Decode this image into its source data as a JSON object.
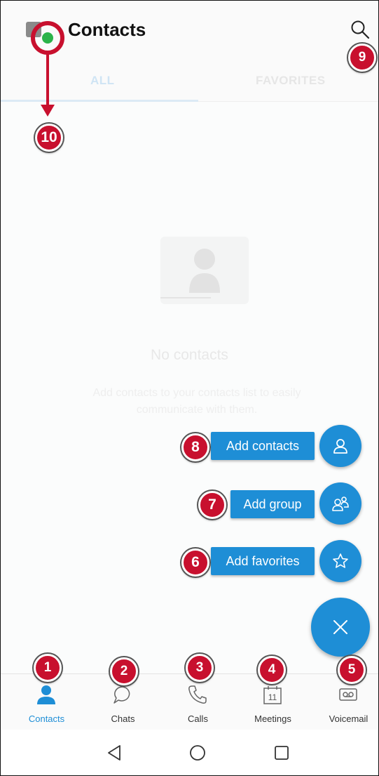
{
  "header": {
    "title": "Contacts"
  },
  "tabs": [
    {
      "label": "ALL"
    },
    {
      "label": "FAVORITES"
    }
  ],
  "empty_state": {
    "title": "No contacts",
    "description": "Add contacts to your contacts list to easily communicate with them."
  },
  "fab_actions": [
    {
      "label": "Add contacts",
      "icon": "person-icon",
      "callout": "8"
    },
    {
      "label": "Add group",
      "icon": "group-icon",
      "callout": "7"
    },
    {
      "label": "Add favorites",
      "icon": "star-icon",
      "callout": "6"
    }
  ],
  "fab_main": {
    "icon": "close-icon"
  },
  "bottom_nav": [
    {
      "label": "Contacts",
      "icon": "person-icon",
      "callout": "1",
      "active": true
    },
    {
      "label": "Chats",
      "icon": "chat-icon",
      "callout": "2"
    },
    {
      "label": "Calls",
      "icon": "phone-icon",
      "callout": "3"
    },
    {
      "label": "Meetings",
      "icon": "calendar-icon",
      "callout": "4",
      "date": "11"
    },
    {
      "label": "Voicemail",
      "icon": "voicemail-icon",
      "callout": "5"
    }
  ],
  "callouts": {
    "search": "9",
    "avatar": "10"
  },
  "colors": {
    "accent": "#1e8ed6",
    "callout": "#c8102e",
    "status_online": "#2bb34a"
  }
}
